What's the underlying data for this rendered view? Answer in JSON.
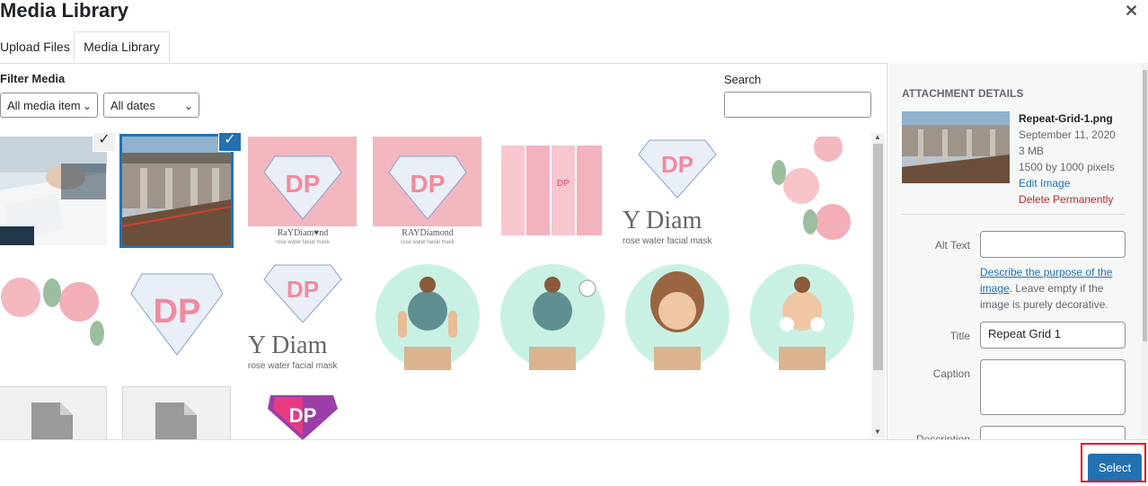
{
  "header": {
    "title": "Media Library",
    "close_icon": "close-icon"
  },
  "tabs": [
    {
      "label": "Upload Files"
    },
    {
      "label": "Media Library"
    }
  ],
  "filter": {
    "label": "Filter Media",
    "type_select": "All media items",
    "date_select": "All dates"
  },
  "search": {
    "label": "Search",
    "value": ""
  },
  "grid": {
    "tiles": [
      {
        "kind": "photo-business",
        "checked": "grey"
      },
      {
        "kind": "photo-construction",
        "checked": "blue"
      },
      {
        "kind": "ray-diamond-pink",
        "caption_1": "RaYDiam♥nd",
        "caption_2": "rose water facial mask"
      },
      {
        "kind": "ray-diamond-pink",
        "caption_1": "RAYDiamond",
        "caption_2": "rose water facial mask"
      },
      {
        "kind": "packaging"
      },
      {
        "kind": "logo-diamond-text",
        "caption_1": "Y Diam",
        "caption_2": "rose water facial mask"
      },
      {
        "kind": "roses-vertical"
      },
      {
        "kind": "roses-horizontal"
      },
      {
        "kind": "logo-diamond"
      },
      {
        "kind": "logo-diamond-text",
        "caption_1": "Y Diam",
        "caption_2": "rose water facial mask"
      },
      {
        "kind": "woman-mask-hands"
      },
      {
        "kind": "woman-mask-clock"
      },
      {
        "kind": "woman-smile"
      },
      {
        "kind": "woman-cream"
      },
      {
        "kind": "document"
      },
      {
        "kind": "document"
      },
      {
        "kind": "logo-dp-small"
      }
    ]
  },
  "details": {
    "heading": "ATTACHMENT DETAILS",
    "filename": "Repeat-Grid-1.png",
    "date": "September 11, 2020",
    "size": "3 MB",
    "dimensions": "1500 by 1000 pixels",
    "edit_link": "Edit Image",
    "delete_link": "Delete Permanently",
    "alt_label": "Alt Text",
    "alt_value": "",
    "help_link": "Describe the purpose of the image",
    "help_text": ". Leave empty if the image is purely decorative.",
    "title_label": "Title",
    "title_value": "Repeat Grid 1",
    "caption_label": "Caption",
    "caption_value": "",
    "description_label": "Description"
  },
  "footer": {
    "select_label": "Select"
  }
}
